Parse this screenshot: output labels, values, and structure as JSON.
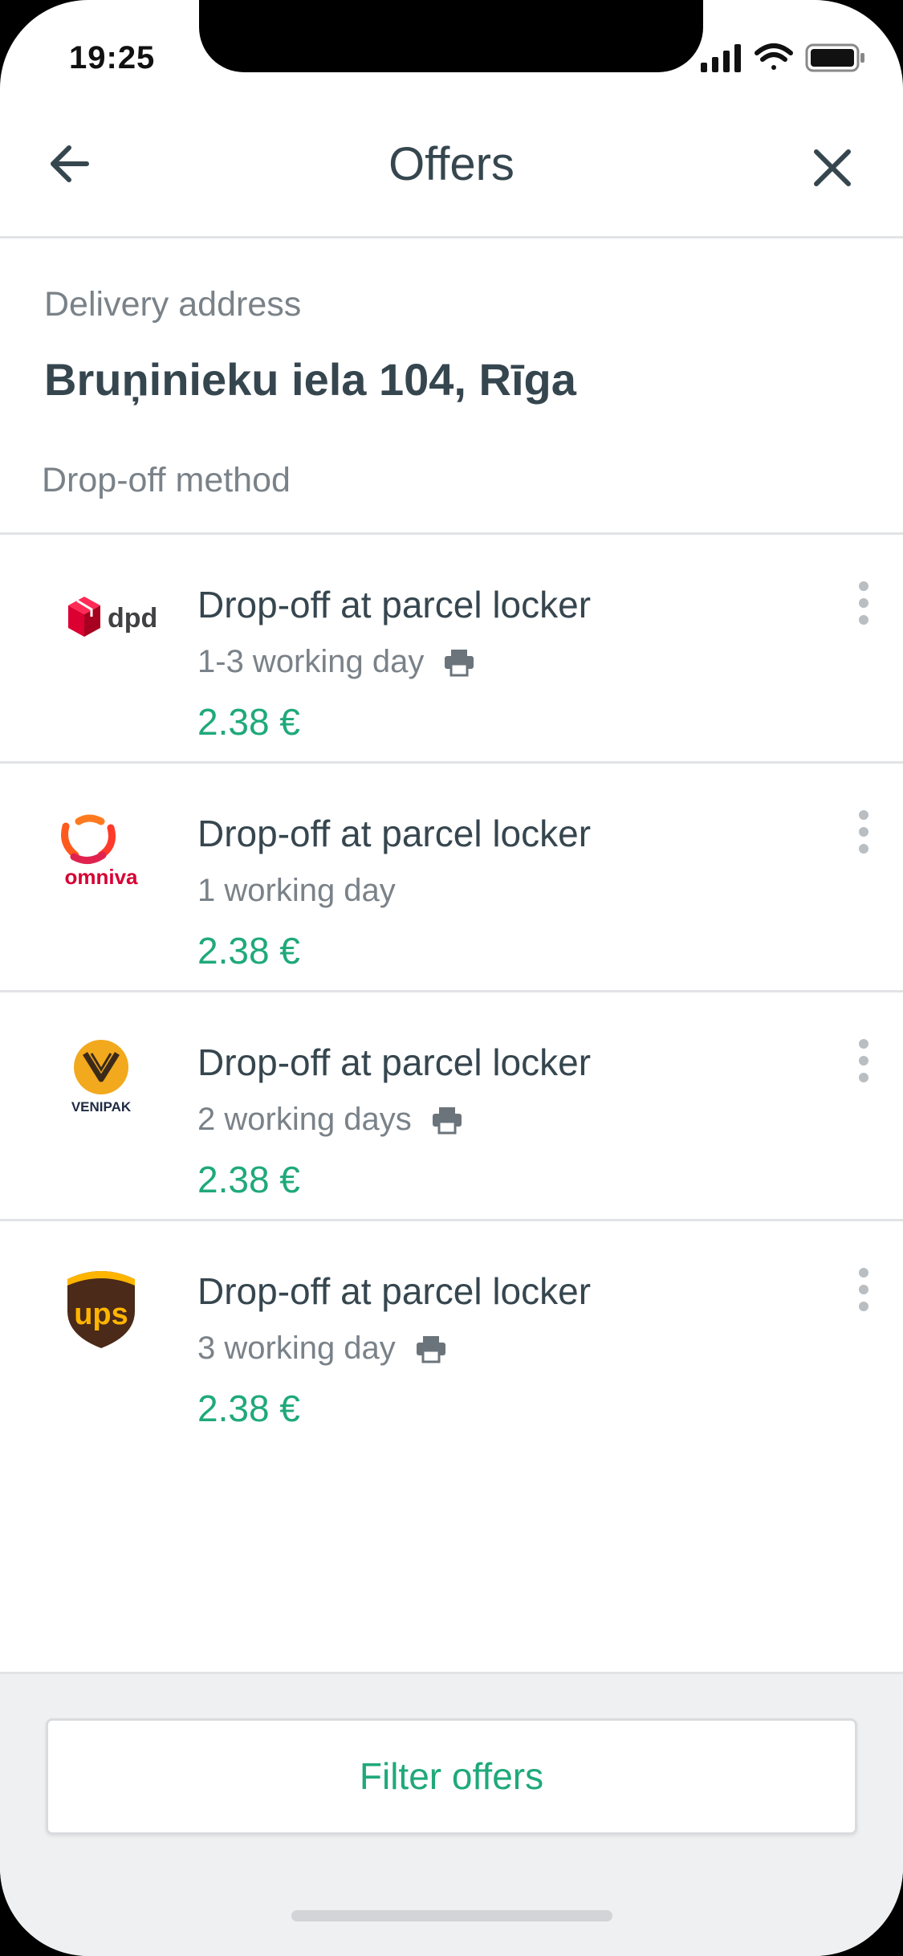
{
  "status_bar": {
    "time": "19:25",
    "icons": [
      "cellular-signal-icon",
      "wifi-icon",
      "battery-icon"
    ]
  },
  "header": {
    "title": "Offers",
    "back_icon": "arrow-left-icon",
    "close_icon": "close-icon"
  },
  "delivery": {
    "label": "Delivery address",
    "address": "Bruņinieku iela 104, Rīga"
  },
  "method": {
    "label": "Drop-off method"
  },
  "offers": [
    {
      "carrier": "dpd",
      "title": "Drop-off at parcel locker",
      "time": "1-3 working day",
      "printer": true,
      "price": "2.38 €"
    },
    {
      "carrier": "omniva",
      "title": "Drop-off at parcel locker",
      "time": "1 working day",
      "printer": false,
      "price": "2.38 €"
    },
    {
      "carrier": "VENIPAK",
      "title": "Drop-off at parcel locker",
      "time": "2 working days",
      "printer": true,
      "price": "2.38 €"
    },
    {
      "carrier": "ups",
      "title": "Drop-off at parcel locker",
      "time": "3 working day",
      "printer": true,
      "price": "2.38 €"
    }
  ],
  "footer": {
    "filter_label": "Filter offers"
  },
  "colors": {
    "accent": "#1fa97a",
    "text_dark": "#36464f",
    "text_muted": "#7a8289",
    "dpd_red": "#dc0032",
    "ups_brown": "#4b2a19",
    "ups_gold": "#ffb500",
    "venipak_gold": "#f2a91e"
  }
}
